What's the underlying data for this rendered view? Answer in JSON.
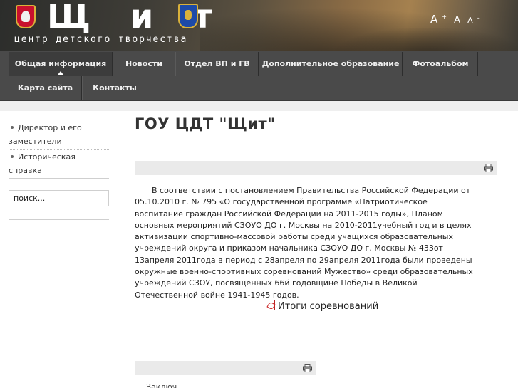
{
  "header": {
    "logo_text": "Щ и т",
    "subtitle": "центр детского творчества",
    "font_controls": {
      "large": "A",
      "large_sup": "+",
      "normal": "A",
      "small": "A",
      "small_sup": "-"
    }
  },
  "nav": {
    "row1": [
      {
        "label": "Общая информация",
        "active": true
      },
      {
        "label": "Новости"
      },
      {
        "label": "Отдел ВП и ГВ"
      },
      {
        "label": "Дополнительное образование"
      },
      {
        "label": "Фотоальбом"
      }
    ],
    "row2": [
      {
        "label": "Карта сайта"
      },
      {
        "label": "Контакты"
      }
    ]
  },
  "sidebar": {
    "links": [
      {
        "label": "Директор и его заместители"
      },
      {
        "label": "Историческая справка"
      }
    ],
    "search": {
      "value": "поиск..."
    }
  },
  "main": {
    "title": "ГОУ ЦДТ \"Щит\"",
    "article": "В соответствии с постановлением Правительства Российской Федерации от 05.10.2010 г. № 795 «О государственной программе «Патриотическое воспитание граждан Российской Федерации на 2011-2015 годы», Планом основных мероприятий СЗОУО ДО г. Москвы на 2010-2011учебный год и в целях активизации спортивно-массовой работы среди учащихся образовательных учреждений округа и приказом начальника СЗОУО ДО г. Москвы № 433от 13апреля 2011года в период с 28апреля по 29апреля 2011года были проведены окружные военно-спортивных соревнований Мужество» среди образовательных учреждений СЗОУ, посвященных 66й годовщине Победы в Великой Отечественной войне 1941-1945 годов.",
    "doc_link": "Итоги соревнований",
    "cut_text": "Заключ... ..."
  }
}
